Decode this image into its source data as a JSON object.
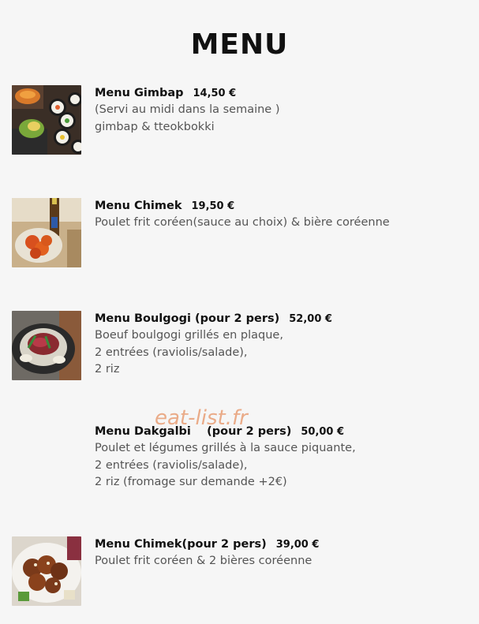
{
  "page": {
    "title": "MENU",
    "watermark": "eat-list.fr"
  },
  "items": [
    {
      "name": "Menu Gimbap",
      "price": "14,50 €",
      "lines": [
        "(Servi au midi dans la semaine )",
        "gimbap & tteokbokki"
      ],
      "image": "gimbap-photo"
    },
    {
      "name": "Menu Chimek",
      "price": "19,50 €",
      "lines": [
        "Poulet frit coréen(sauce au choix) & bière coréenne"
      ],
      "image": "fried-chicken-beer-photo"
    },
    {
      "name": "Menu Boulgogi (pour 2 pers)",
      "price": "52,00 €",
      "lines": [
        "Boeuf boulgogi grillés en plaque,",
        "2 entrées (raviolis/salade),",
        "2 riz"
      ],
      "image": "bulgogi-plate-photo"
    },
    {
      "name": "Menu Dakgalbi    (pour 2 pers)",
      "price": "50,00 €",
      "lines": [
        "Poulet et légumes grillés à la sauce piquante,",
        "2 entrées (raviolis/salade),",
        "2 riz (fromage sur demande +2€)"
      ],
      "image": ""
    },
    {
      "name": "Menu Chimek(pour 2 pers)",
      "price": "39,00 €",
      "lines": [
        "Poulet frit coréen & 2 bières coréenne"
      ],
      "image": "fried-chicken-platter-photo"
    }
  ]
}
